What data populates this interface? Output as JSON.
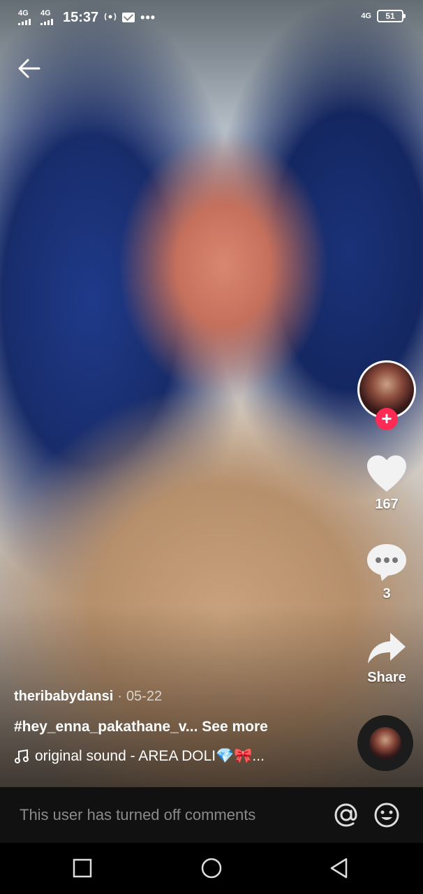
{
  "status_bar": {
    "network_left_1": "4G",
    "network_left_2": "4G",
    "time": "15:37",
    "more_dots": "•••",
    "network_right": "4G",
    "battery": "51"
  },
  "video": {
    "author": "theribabydansi",
    "date_separator": "·",
    "date": "05-22",
    "hashtag_caption": "#hey_enna_pakathane_v...",
    "see_more": "See more",
    "sound": "original sound - AREA DOLI💎🎀..."
  },
  "actions": {
    "follow_symbol": "+",
    "likes": "167",
    "comments": "3",
    "share_label": "Share"
  },
  "comment_bar": {
    "placeholder": "This user has turned off comments"
  },
  "colors": {
    "follow_red": "#fe2c55",
    "comment_bar_bg": "#111111"
  }
}
